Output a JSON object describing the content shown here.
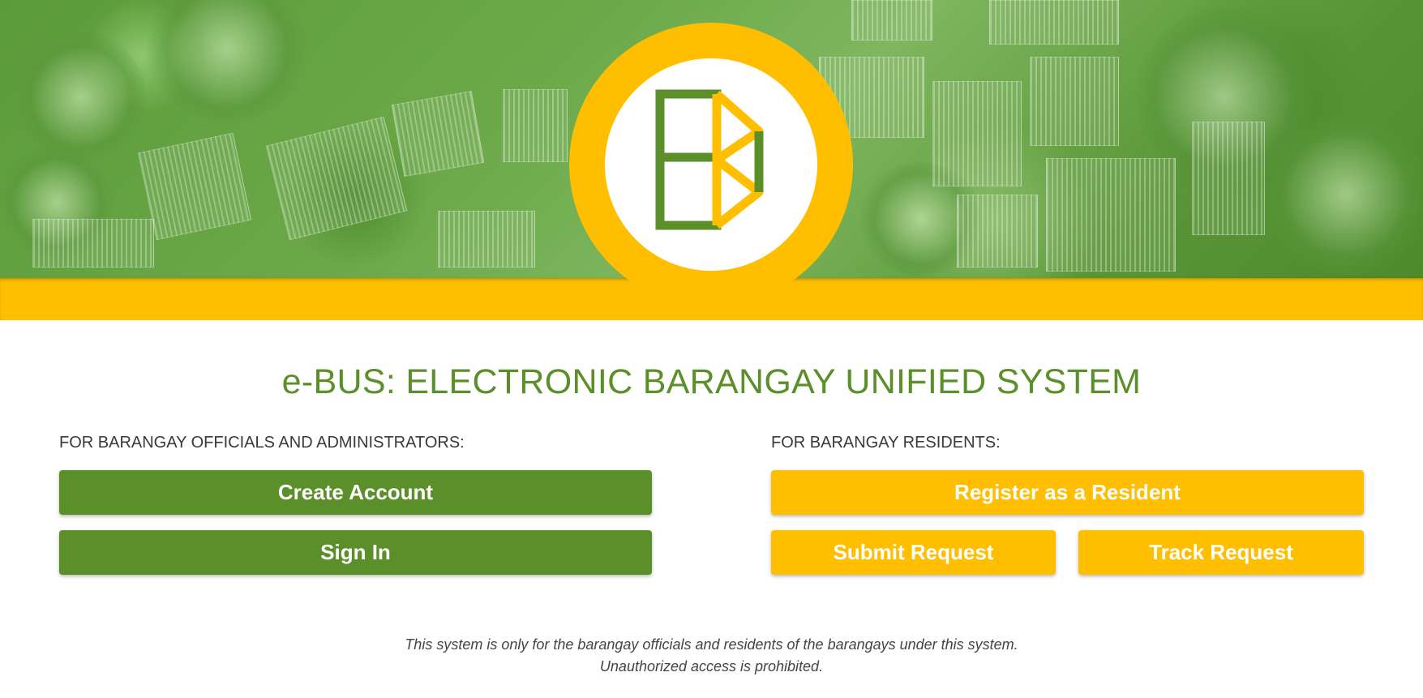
{
  "hero": {
    "logo_icon": "ebus-logo-icon",
    "colors": {
      "green": "#5a8f29",
      "yellow": "#ffbf00"
    }
  },
  "title": "e-BUS: ELECTRONIC BARANGAY UNIFIED SYSTEM",
  "officials": {
    "label": "FOR BARANGAY OFFICIALS AND ADMINISTRATORS:",
    "create_account": "Create Account",
    "sign_in": "Sign In"
  },
  "residents": {
    "label": "FOR BARANGAY RESIDENTS:",
    "register": "Register as a Resident",
    "submit_request": "Submit Request",
    "track_request": "Track Request"
  },
  "footer": {
    "line1": "This system is only for the barangay officials and residents of the barangays under this system.",
    "line2": "Unauthorized access is prohibited."
  }
}
